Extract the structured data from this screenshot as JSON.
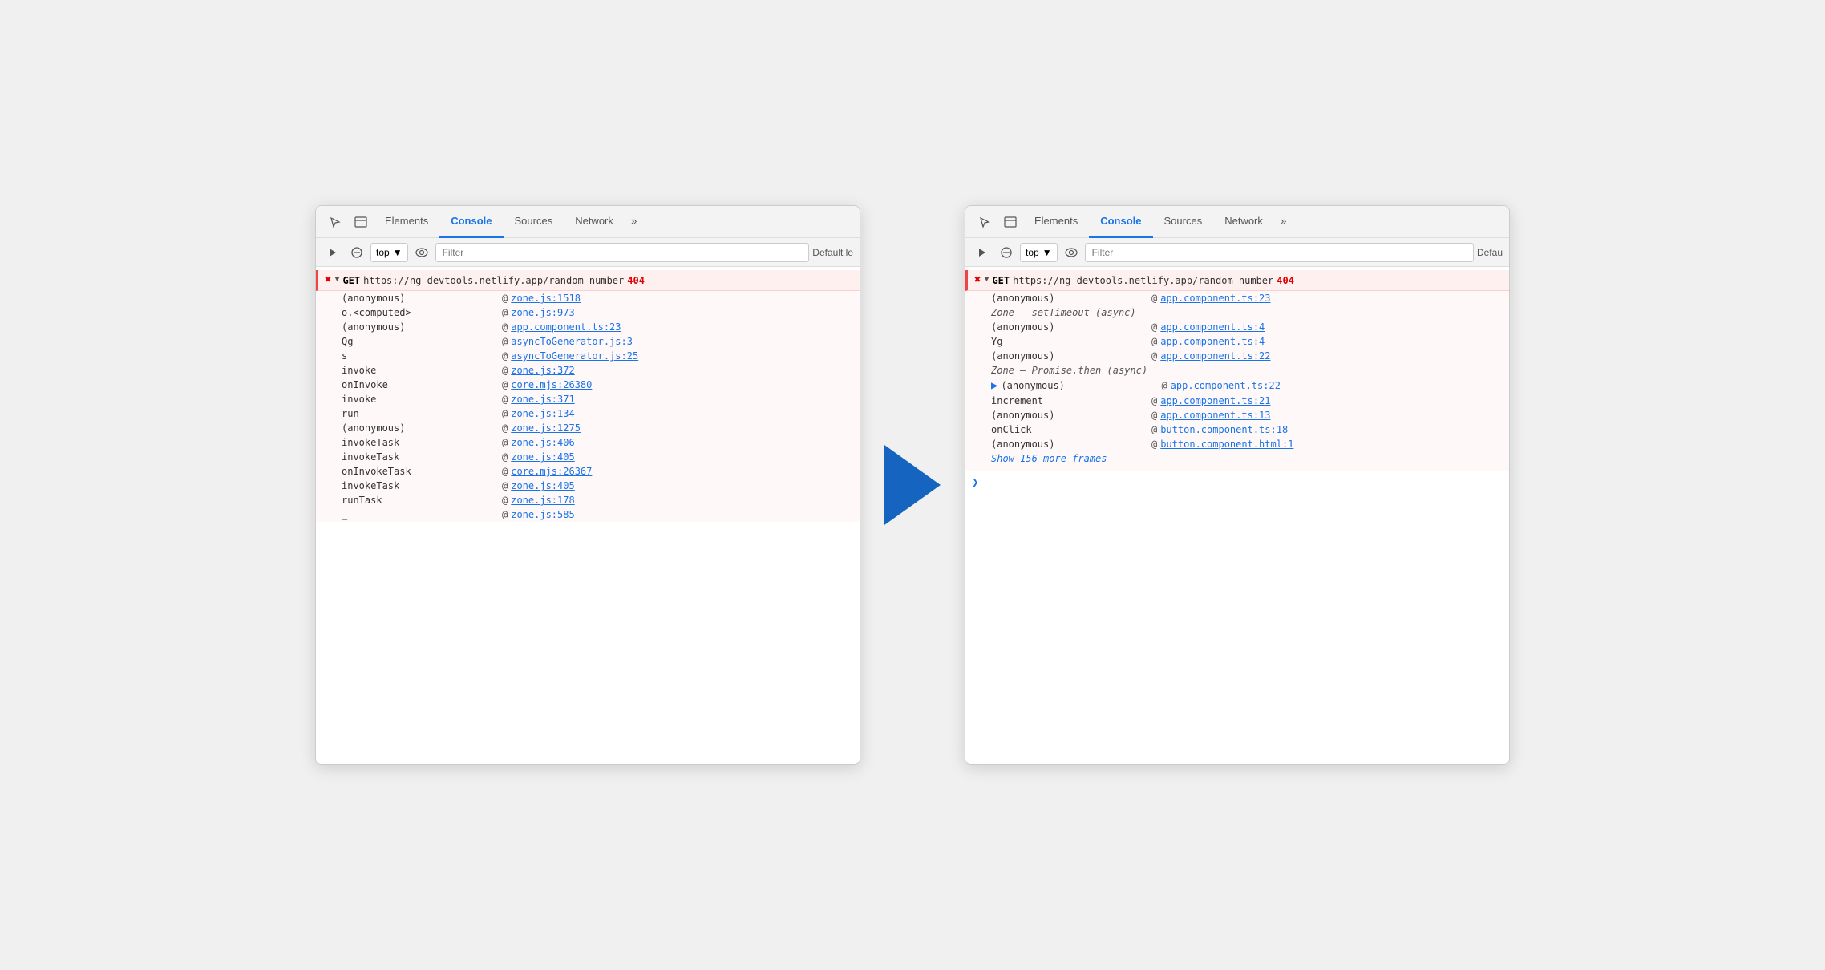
{
  "left_panel": {
    "tabs": [
      {
        "label": "Elements",
        "active": false
      },
      {
        "label": "Console",
        "active": true
      },
      {
        "label": "Sources",
        "active": false
      },
      {
        "label": "Network",
        "active": false
      },
      {
        "label": "»",
        "active": false
      }
    ],
    "toolbar": {
      "top_label": "top",
      "filter_placeholder": "Filter",
      "default_level": "Default le"
    },
    "error": {
      "method": "GET",
      "url": "https://ng-devtools.netlify.app/random-number",
      "status": "404"
    },
    "stack_frames": [
      {
        "fn": "(anonymous)",
        "at": "@",
        "link": "zone.js:1518"
      },
      {
        "fn": "o.<computed>",
        "at": "@",
        "link": "zone.js:973"
      },
      {
        "fn": "(anonymous)",
        "at": "@",
        "link": "app.component.ts:23"
      },
      {
        "fn": "Qg",
        "at": "@",
        "link": "asyncToGenerator.js:3"
      },
      {
        "fn": "s",
        "at": "@",
        "link": "asyncToGenerator.js:25"
      },
      {
        "fn": "invoke",
        "at": "@",
        "link": "zone.js:372"
      },
      {
        "fn": "onInvoke",
        "at": "@",
        "link": "core.mjs:26380"
      },
      {
        "fn": "invoke",
        "at": "@",
        "link": "zone.js:371"
      },
      {
        "fn": "run",
        "at": "@",
        "link": "zone.js:134"
      },
      {
        "fn": "(anonymous)",
        "at": "@",
        "link": "zone.js:1275"
      },
      {
        "fn": "invokeTask",
        "at": "@",
        "link": "zone.js:406"
      },
      {
        "fn": "invokeTask",
        "at": "@",
        "link": "zone.js:405"
      },
      {
        "fn": "onInvokeTask",
        "at": "@",
        "link": "core.mjs:26367"
      },
      {
        "fn": "invokeTask",
        "at": "@",
        "link": "zone.js:405"
      },
      {
        "fn": "runTask",
        "at": "@",
        "link": "zone.js:178"
      },
      {
        "fn": "_",
        "at": "@",
        "link": "zone.js:585"
      }
    ]
  },
  "right_panel": {
    "tabs": [
      {
        "label": "Elements",
        "active": false
      },
      {
        "label": "Console",
        "active": true
      },
      {
        "label": "Sources",
        "active": false
      },
      {
        "label": "Network",
        "active": false
      },
      {
        "label": "»",
        "active": false
      }
    ],
    "toolbar": {
      "top_label": "top",
      "filter_placeholder": "Filter",
      "default_level": "Defau"
    },
    "error": {
      "method": "GET",
      "url": "https://ng-devtools.netlify.app/random-number",
      "status": "404"
    },
    "stack_frames": [
      {
        "fn": "(anonymous)",
        "at": "@",
        "link": "app.component.ts:23",
        "async": null
      },
      {
        "fn": "Zone — setTimeout (async)",
        "async": true
      },
      {
        "fn": "(anonymous)",
        "at": "@",
        "link": "app.component.ts:4"
      },
      {
        "fn": "Yg",
        "at": "@",
        "link": "app.component.ts:4"
      },
      {
        "fn": "(anonymous)",
        "at": "@",
        "link": "app.component.ts:22"
      },
      {
        "fn": "Zone — Promise.then (async)",
        "async": true
      },
      {
        "fn": "(anonymous)",
        "at": "@",
        "link": "app.component.ts:22",
        "arrow": true
      },
      {
        "fn": "increment",
        "at": "@",
        "link": "app.component.ts:21"
      },
      {
        "fn": "(anonymous)",
        "at": "@",
        "link": "app.component.ts:13"
      },
      {
        "fn": "onClick",
        "at": "@",
        "link": "button.component.ts:18"
      },
      {
        "fn": "(anonymous)",
        "at": "@",
        "link": "button.component.html:1"
      }
    ],
    "show_more": "Show 156 more frames"
  }
}
